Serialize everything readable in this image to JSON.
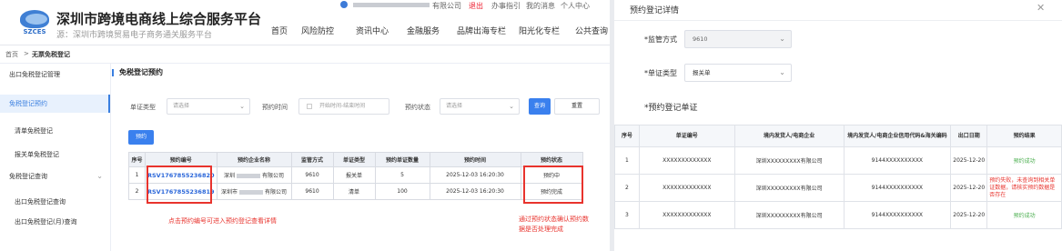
{
  "header": {
    "site_title": "深圳市跨境电商线上综合服务平台",
    "site_subtitle": "源：深圳市跨境贸易电子商务通关服务平台",
    "logo_text": "SZCES",
    "company_suffix": "有限公司",
    "logout": "退出",
    "guide": "办事指引",
    "messages": "我的消息",
    "personal": "个人中心",
    "nav": [
      "首页",
      "风险防控",
      "资讯中心",
      "金融服务",
      "品牌出海专栏",
      "阳光化专栏",
      "公共查询"
    ]
  },
  "breadcrumb": [
    "首页",
    ">",
    "无票免税登记"
  ],
  "sidebar": {
    "items": [
      {
        "label": "出口免税登记管理"
      },
      {
        "label": "免税登记预约"
      },
      {
        "label": "清单免税登记"
      },
      {
        "label": "报关单免税登记"
      },
      {
        "label": "免税登记查询"
      },
      {
        "label": "出口免税登记查询"
      },
      {
        "label": "出口免税登记(月)查询"
      }
    ]
  },
  "main": {
    "page_title": "免税登记预约",
    "filters": {
      "doc_type_label": "单证类型",
      "doc_type_value": "请选择",
      "time_label": "预约时间",
      "time_placeholder": "开始时间-结束时间",
      "status_label": "预约状态",
      "status_value": "请选择",
      "search_button": "查询",
      "reset_button": "重置"
    },
    "reserve_button": "预约",
    "table": {
      "headers": [
        "序号",
        "预约编号",
        "预约企业名称",
        "监管方式",
        "单证类型",
        "预约单证数量",
        "预约时间",
        "预约状态"
      ],
      "rows": [
        {
          "no": "1",
          "id": "RSV1767855236820",
          "company_a": "深圳",
          "company_b": "有限",
          "company_c": "公司",
          "method": "9610",
          "doc_type": "报关单",
          "count": "5",
          "time": "2025-12-03 16:20:30",
          "status": "预约中"
        },
        {
          "no": "2",
          "id": "RSV1767855236819",
          "company_a": "深圳市",
          "company_b": "有限",
          "company_c": "公司",
          "method": "9610",
          "doc_type": "清单",
          "count": "100",
          "time": "2025-12-03 16:20:30",
          "status": "预约完成"
        }
      ]
    },
    "note_left": "点击预约编号可进入预约登记查看详情",
    "note_right_line1": "通过预约状态确认预约数",
    "note_right_line2": "据是否处理完成"
  },
  "dialog": {
    "title": "预约登记详情",
    "close_icon": "close-icon",
    "method_label": "*监管方式",
    "method_value": "9610",
    "doc_type_label": "*单证类型",
    "doc_type_value": "报关单",
    "section_label": "*预约登记单证",
    "table": {
      "headers": [
        "序号",
        "单证编号",
        "境内发货人/电商企业",
        "境内发货人/电商企业信用代码&海关编码",
        "出口日期",
        "预约结果"
      ],
      "rows": [
        {
          "no": "1",
          "doc_no": "XXXXXXXXXXXXX",
          "shipper": "深圳XXXXXXXXX有限公司",
          "code": "9144XXXXXXXXXX",
          "date": "2025-12-20",
          "result": "预约成功",
          "state": "ok"
        },
        {
          "no": "2",
          "doc_no": "XXXXXXXXXXXXX",
          "shipper": "深圳XXXXXXXXX有限公司",
          "code": "9144XXXXXXXXXX",
          "date": "2025-12-20",
          "result": "预约失败，未查询到相关单证数据，请核实预约数据是否存在",
          "state": "fail"
        },
        {
          "no": "3",
          "doc_no": "XXXXXXXXXXXXX",
          "shipper": "深圳XXXXXXXXX有限公司",
          "code": "9144XXXXXXXXXX",
          "date": "2025-12-20",
          "result": "预约成功",
          "state": "ok"
        }
      ]
    }
  },
  "colors": {
    "accent": "#3a80ee",
    "link": "#2a66d9",
    "highlight": "#e8332d",
    "success": "#4caf50"
  }
}
